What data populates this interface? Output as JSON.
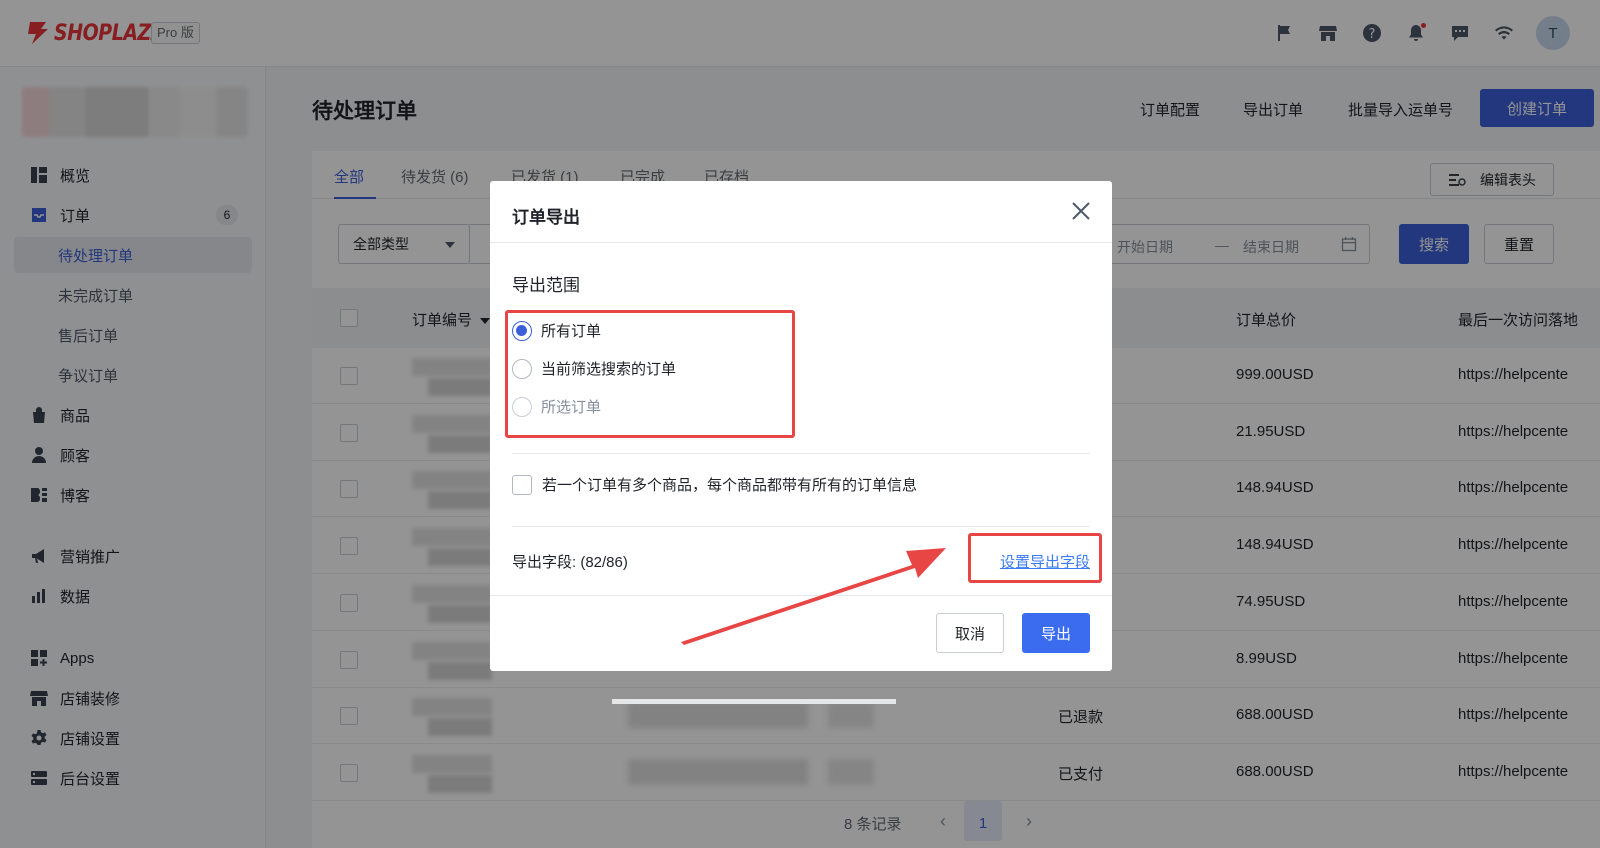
{
  "brand": {
    "name": "SHOPLAZZA",
    "plan": "Pro 版",
    "accent": "#e8343a"
  },
  "topbar": {
    "avatar_initial": "T",
    "icons": [
      "flag-icon",
      "store-icon",
      "help-icon",
      "bell-icon",
      "message-icon",
      "wifi-icon"
    ]
  },
  "sidebar": {
    "items": [
      {
        "label": "概览",
        "icon": "dashboard-icon"
      },
      {
        "label": "订单",
        "icon": "order-icon",
        "count": "6"
      },
      {
        "label": "待处理订单",
        "sub": true,
        "active": true
      },
      {
        "label": "未完成订单",
        "sub": true
      },
      {
        "label": "售后订单",
        "sub": true
      },
      {
        "label": "争议订单",
        "sub": true
      },
      {
        "label": "商品",
        "icon": "bag-icon"
      },
      {
        "label": "顾客",
        "icon": "user-icon"
      },
      {
        "label": "博客",
        "icon": "blog-icon"
      },
      {
        "label": "营销推广",
        "icon": "megaphone-icon"
      },
      {
        "label": "数据",
        "icon": "bar-chart-icon"
      },
      {
        "label": "Apps",
        "icon": "apps-icon"
      },
      {
        "label": "店铺装修",
        "icon": "store-icon"
      },
      {
        "label": "店铺设置",
        "icon": "gear-icon"
      },
      {
        "label": "后台设置",
        "icon": "server-icon"
      }
    ]
  },
  "header": {
    "title": "待处理订单",
    "links": [
      "订单配置",
      "导出订单",
      "批量导入运单号"
    ],
    "create_label": "创建订单"
  },
  "tabs": [
    {
      "label": "全部",
      "active": true
    },
    {
      "label": "待发货 (6)"
    },
    {
      "label": "已发货 (1)"
    },
    {
      "label": "已完成"
    },
    {
      "label": "已存档"
    }
  ],
  "toolbar": {
    "edit_header_label": "编辑表头",
    "type_select": "全部类型",
    "date_start_placeholder": "开始日期",
    "date_separator": "—",
    "date_end_placeholder": "结束日期",
    "search_label": "搜索",
    "reset_label": "重置"
  },
  "table": {
    "columns": [
      "订单编号",
      "订单总价",
      "最后一次访问落地"
    ],
    "rows": [
      {
        "status": "",
        "total": "999.00USD",
        "landing": "https://helpcente"
      },
      {
        "status": "",
        "total": "21.95USD",
        "landing": "https://helpcente"
      },
      {
        "status": "",
        "total": "148.94USD",
        "landing": "https://helpcente"
      },
      {
        "status": "",
        "total": "148.94USD",
        "landing": "https://helpcente"
      },
      {
        "status": "",
        "total": "74.95USD",
        "landing": "https://helpcente"
      },
      {
        "status": "",
        "total": "8.99USD",
        "landing": "https://helpcente"
      },
      {
        "status": "已退款",
        "total": "688.00USD",
        "landing": "https://helpcente"
      },
      {
        "status": "已支付",
        "total": "688.00USD",
        "landing": "https://helpcente"
      }
    ]
  },
  "pagination": {
    "total_label": "8 条记录",
    "current_page": "1"
  },
  "modal": {
    "title": "订单导出",
    "section_label": "导出范围",
    "options": [
      {
        "label": "所有订单",
        "checked": true
      },
      {
        "label": "当前筛选搜索的订单"
      },
      {
        "label": "所选订单",
        "disabled": true
      }
    ],
    "multi_product_label": "若一个订单有多个商品，每个商品都带有所有的订单信息",
    "fields_label": "导出字段: (82/86)",
    "fields_link": "设置导出字段",
    "cancel_label": "取消",
    "export_label": "导出"
  },
  "annotation_color": "#e84545"
}
